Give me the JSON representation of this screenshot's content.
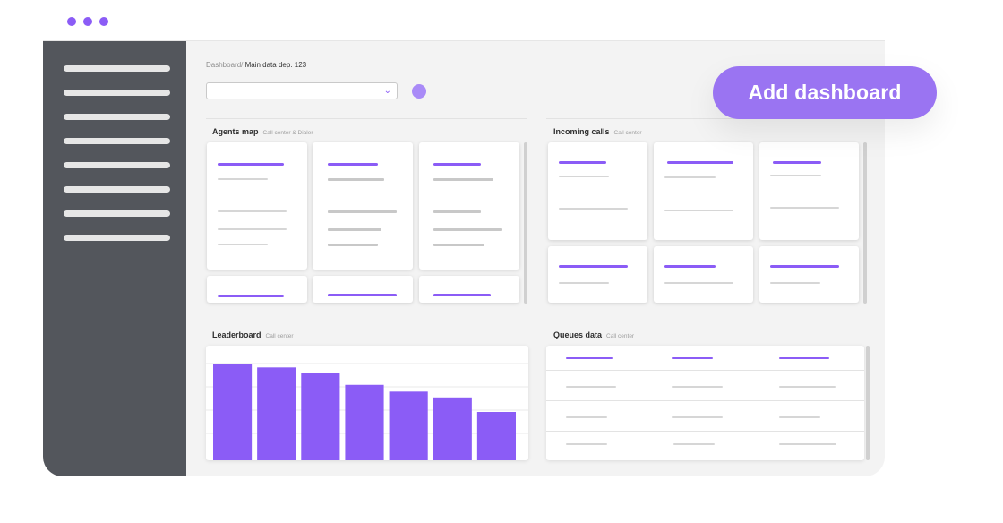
{
  "window": {
    "controls": [
      "dot",
      "dot",
      "dot"
    ]
  },
  "breadcrumb": {
    "root": "Dashboard/",
    "current": "Main data dep. 123"
  },
  "filter_select": {
    "value": "",
    "icon": "chevron-down-icon"
  },
  "add_dashboard": {
    "label": "Add dashboard"
  },
  "sections": {
    "agents_map": {
      "title": "Agents map",
      "tag": "Call center & Dialer"
    },
    "incoming_calls": {
      "title": "Incoming calls",
      "tag": "Call center"
    },
    "leaderboard": {
      "title": "Leaderboard",
      "tag": "Call center"
    },
    "queues_data": {
      "title": "Queues data",
      "tag": "Call center"
    }
  },
  "colors": {
    "accent": "#8b5cf6",
    "sidebar": "#53565c",
    "button": "#9a74f2",
    "background": "#f3f3f3"
  },
  "chart_data": {
    "type": "bar",
    "categories": [
      "",
      "",
      "",
      "",
      "",
      "",
      ""
    ],
    "values": [
      100,
      96,
      90,
      78,
      71,
      65,
      50
    ],
    "ylim": [
      0,
      100
    ],
    "grid": true
  }
}
